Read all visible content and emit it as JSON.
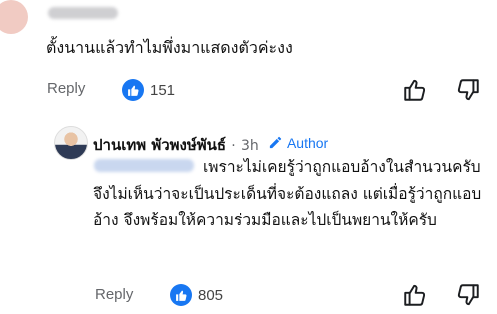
{
  "comment1": {
    "text": "ตั้งนานแล้วทำไมพึ่งมาแสดงตัวค่ะงง",
    "reply_label": "Reply",
    "like_count": "151"
  },
  "comment2": {
    "author": "ปานเทพ พัวพงษ์พันธ์",
    "separator": "·",
    "time": "3h",
    "badge": "Author",
    "text": "เพราะไม่เคยรู้ว่าถูกแอบอ้างในสำนวนครับ จึงไม่เห็นว่าจะเป็นประเด็นที่จะต้องแถลง แต่เมื่อรู้ว่าถูกแอบอ้าง จึงพร้อมให้ความร่วมมือและไปเป็นพยานให้ครับ",
    "reply_label": "Reply",
    "like_count": "805"
  },
  "colors": {
    "accent": "#1877f2",
    "muted": "#65676b"
  },
  "icons": [
    "thumbs-up-icon",
    "thumbs-down-icon",
    "pencil-icon"
  ]
}
